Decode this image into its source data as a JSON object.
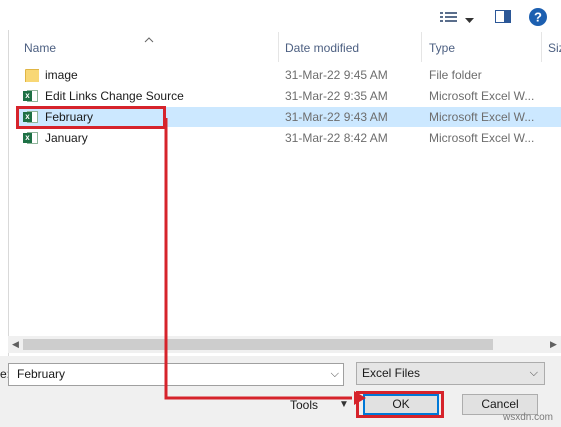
{
  "toolbar": {
    "view_icon": "view-details-icon",
    "pane_icon": "preview-pane-icon",
    "help_icon": "help-icon",
    "help_label": "?"
  },
  "columns": {
    "name": "Name",
    "date": "Date modified",
    "type": "Type",
    "size": "Siz"
  },
  "files": [
    {
      "name": "image",
      "date": "31-Mar-22 9:45 AM",
      "type": "File folder",
      "icon": "folder-icon"
    },
    {
      "name": "Edit Links Change Source",
      "date": "31-Mar-22 9:35 AM",
      "type": "Microsoft Excel W...",
      "icon": "excel-file-icon"
    },
    {
      "name": "February",
      "date": "31-Mar-22 9:43 AM",
      "type": "Microsoft Excel W...",
      "icon": "excel-file-icon",
      "selected": true
    },
    {
      "name": "January",
      "date": "31-Mar-22 8:42 AM",
      "type": "Microsoft Excel W...",
      "icon": "excel-file-icon"
    }
  ],
  "bottom": {
    "filename_label_fragment": "e:",
    "filename_value": "February",
    "filetype_value": "Excel Files",
    "tools_label": "Tools",
    "ok_label": "OK",
    "cancel_label": "Cancel"
  },
  "watermark": "wsxdn.com",
  "colors": {
    "selection": "#cce8ff",
    "annotation": "#d6232b",
    "accent": "#0078d7",
    "excel_green": "#1e7145"
  }
}
